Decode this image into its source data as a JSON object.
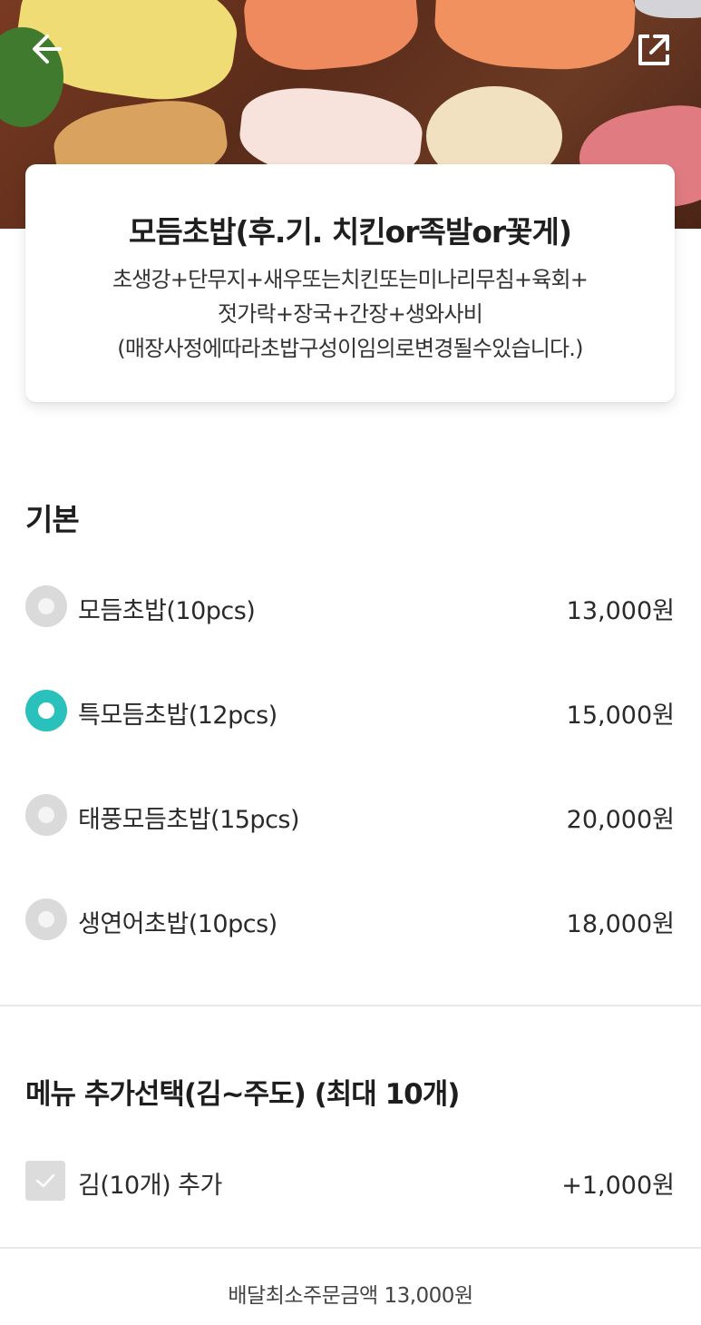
{
  "menu": {
    "title": "모듬초밥(후.기. 치킨or족발or꽃게)",
    "description_lines": [
      "초생강+단무지+새우또는치킨또는미나리무침+육회+",
      "젓가락+장국+간장+생와사비",
      "(매장사정에따라초밥구성이임의로변경될수있습니다.)"
    ]
  },
  "sections": {
    "basic": {
      "title": "기본",
      "options": [
        {
          "label": "모듬초밥(10pcs)",
          "price": "13,000원",
          "selected": false
        },
        {
          "label": "특모듬초밥(12pcs)",
          "price": "15,000원",
          "selected": true
        },
        {
          "label": "태풍모듬초밥(15pcs)",
          "price": "20,000원",
          "selected": false
        },
        {
          "label": "생연어초밥(10pcs)",
          "price": "18,000원",
          "selected": false
        }
      ]
    },
    "extra": {
      "title": "메뉴 추가선택(김~주도) (최대 10개)",
      "options": [
        {
          "label": "김(10개) 추가",
          "price": "+1,000원",
          "checked": false
        }
      ]
    }
  },
  "footer": {
    "min_order": "배달최소주문금액 13,000원"
  },
  "icons": {
    "back": "back-arrow-icon",
    "share": "share-external-icon"
  },
  "colors": {
    "accent": "#2ac1bc",
    "radio_off": "#dadada",
    "checkbox_off": "#dcdcdc"
  }
}
